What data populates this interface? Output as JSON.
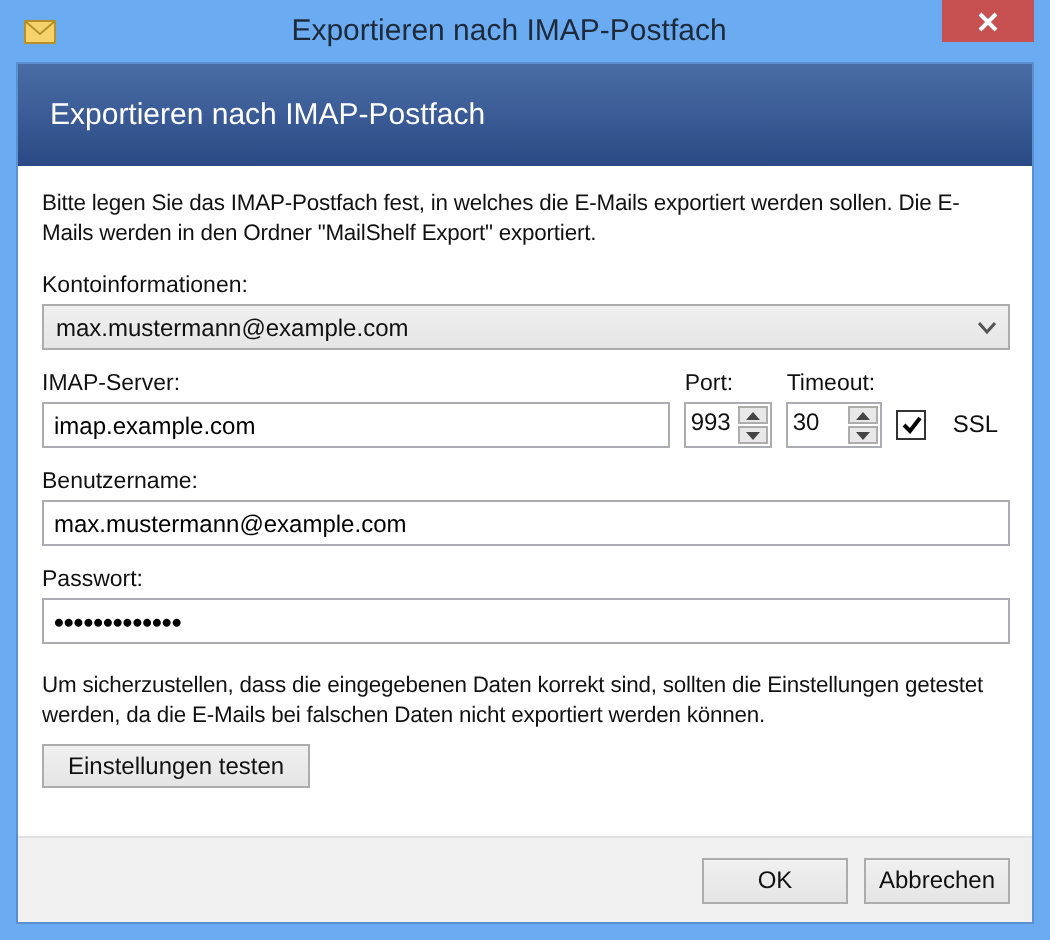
{
  "window": {
    "title": "Exportieren nach IMAP-Postfach"
  },
  "header": {
    "title": "Exportieren nach IMAP-Postfach"
  },
  "description": "Bitte legen Sie das IMAP-Postfach fest, in welches die E-Mails exportiert werden sollen. Die E-Mails werden in den Ordner \"MailShelf Export\" exportiert.",
  "account": {
    "label": "Kontoinformationen:",
    "value": "max.mustermann@example.com"
  },
  "server": {
    "label": "IMAP-Server:",
    "value": "imap.example.com"
  },
  "port": {
    "label": "Port:",
    "value": "993"
  },
  "timeout": {
    "label": "Timeout:",
    "value": "30"
  },
  "ssl": {
    "label": "SSL",
    "checked": true
  },
  "username": {
    "label": "Benutzername:",
    "value": "max.mustermann@example.com"
  },
  "password": {
    "label": "Passwort:",
    "value": "•••••••••••••"
  },
  "note": "Um sicherzustellen, dass die eingegebenen Daten korrekt sind, sollten die Einstellungen getestet werden, da die E-Mails bei falschen Daten nicht exportiert werden können.",
  "test_button": "Einstellungen testen",
  "buttons": [
    "OK",
    "Abbrechen"
  ]
}
